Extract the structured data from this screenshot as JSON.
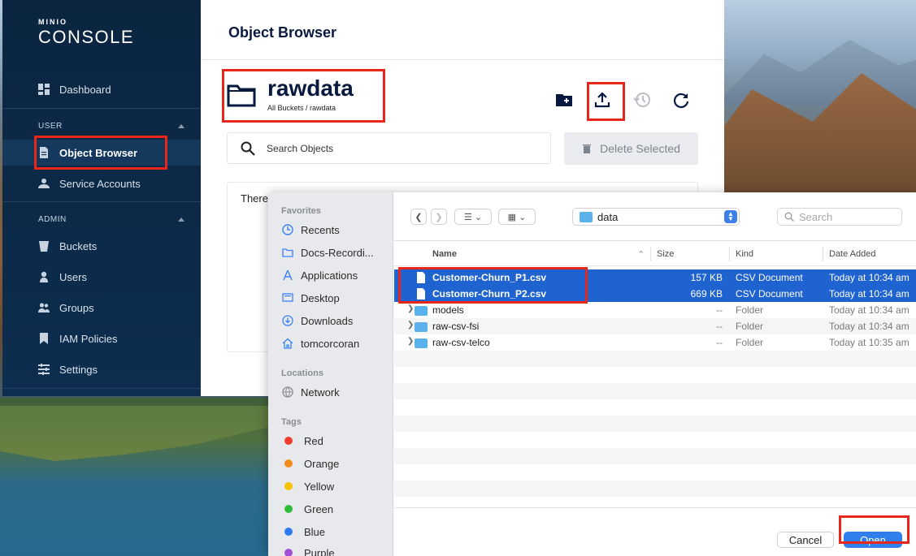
{
  "console": {
    "logo_top": "MINIO",
    "logo_main": "CONSOLE",
    "nav": {
      "dashboard": "Dashboard",
      "user_section": "USER",
      "object_browser": "Object Browser",
      "service_accounts": "Service Accounts",
      "admin_section": "ADMIN",
      "buckets": "Buckets",
      "users": "Users",
      "groups": "Groups",
      "iam_policies": "IAM Policies",
      "settings": "Settings"
    },
    "page_title": "Object Browser",
    "bucket_name": "rawdata",
    "bucket_path": "All Buckets / rawdata",
    "search_placeholder": "Search Objects",
    "delete_label": "Delete Selected",
    "empty_text": "There"
  },
  "dialog": {
    "sidebar": {
      "favorites_head": "Favorites",
      "favorites": [
        "Recents",
        "Docs-Recordi...",
        "Applications",
        "Desktop",
        "Downloads",
        "tomcorcoran"
      ],
      "locations_head": "Locations",
      "locations": [
        "Network"
      ],
      "tags_head": "Tags",
      "tags": [
        {
          "name": "Red",
          "color": "#ef3b30"
        },
        {
          "name": "Orange",
          "color": "#f08c1a"
        },
        {
          "name": "Yellow",
          "color": "#f5c400"
        },
        {
          "name": "Green",
          "color": "#2ebd3a"
        },
        {
          "name": "Blue",
          "color": "#2b7bf0"
        },
        {
          "name": "Purple",
          "color": "#a54fd6"
        }
      ]
    },
    "path": "data",
    "search_placeholder": "Search",
    "columns": {
      "name": "Name",
      "size": "Size",
      "kind": "Kind",
      "date": "Date Added"
    },
    "files": [
      {
        "name": "Customer-Churn_P1.csv",
        "size": "157 KB",
        "kind": "CSV Document",
        "date": "Today at 10:34 am",
        "selected": true
      },
      {
        "name": "Customer-Churn_P2.csv",
        "size": "669 KB",
        "kind": "CSV Document",
        "date": "Today at 10:34 am",
        "selected": true
      },
      {
        "name": "models",
        "size": "--",
        "kind": "Folder",
        "date": "Today at 10:34 am"
      },
      {
        "name": "raw-csv-fsi",
        "size": "--",
        "kind": "Folder",
        "date": "Today at 10:34 am"
      },
      {
        "name": "raw-csv-telco",
        "size": "--",
        "kind": "Folder",
        "date": "Today at 10:35 am"
      }
    ],
    "cancel_label": "Cancel",
    "open_label": "Open"
  },
  "colors": {
    "annotation": "#e8271a",
    "accent": "#2f80ed",
    "selection": "#1f63d1",
    "sidebar": "#0c2a49"
  }
}
